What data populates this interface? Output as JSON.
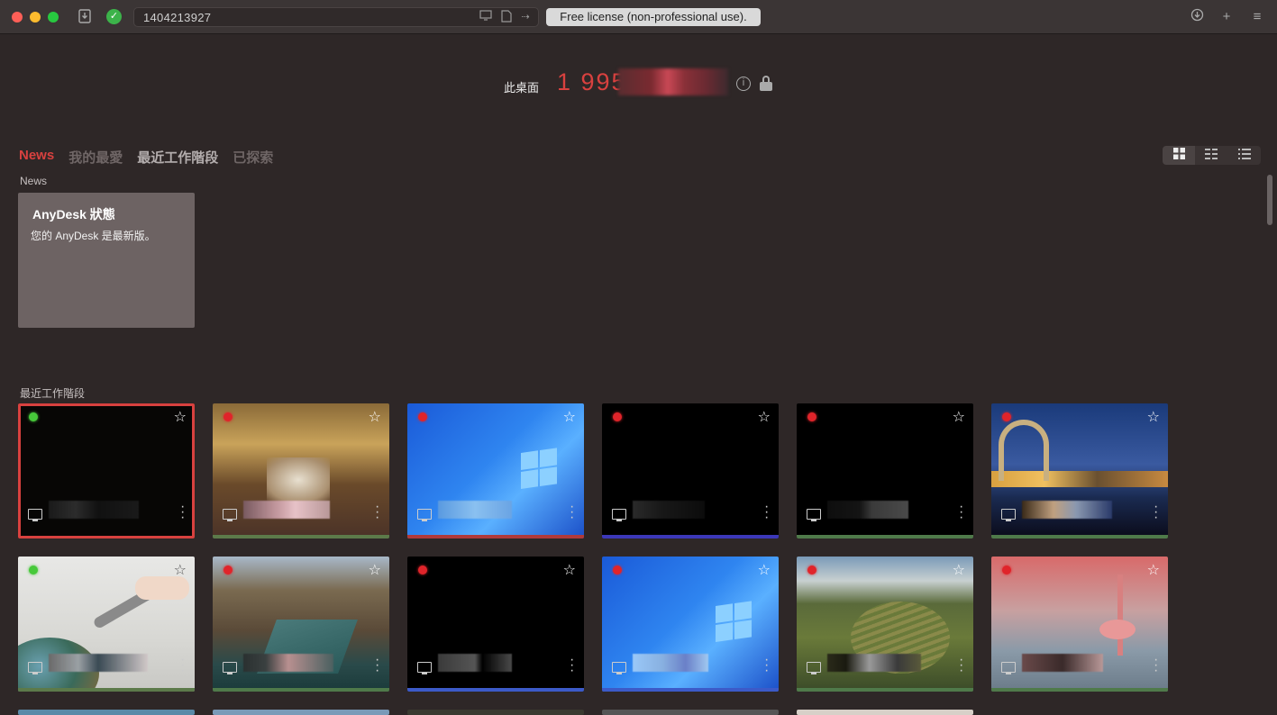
{
  "titlebar": {
    "address": "1404213927",
    "license": "Free license (non-professional use)."
  },
  "desk": {
    "label": "此桌面",
    "id_visible": "1 995"
  },
  "tabs": [
    "News",
    "我的最愛",
    "最近工作階段",
    "已探索"
  ],
  "sections": {
    "news": "News",
    "recent": "最近工作階段"
  },
  "news_card": {
    "title": "AnyDesk 狀態",
    "body": "您的 AnyDesk 是最新版。"
  },
  "thumb_status": [
    "online",
    "offline",
    "offline",
    "offline",
    "offline",
    "offline",
    "online",
    "offline",
    "offline",
    "offline",
    "offline",
    "offline"
  ],
  "icons": [
    "download-icon",
    "check-icon",
    "monitor-icon",
    "file-icon",
    "forward-icon",
    "update-icon",
    "plus-icon",
    "menu-icon",
    "info-icon",
    "lock-icon",
    "grid-view-icon",
    "list-view-icon",
    "detail-view-icon",
    "star-icon",
    "kebab-icon"
  ],
  "colors": {
    "accent": "#d8413f",
    "background": "#2e2727",
    "online": "#47c93a",
    "offline": "#e0242a"
  }
}
